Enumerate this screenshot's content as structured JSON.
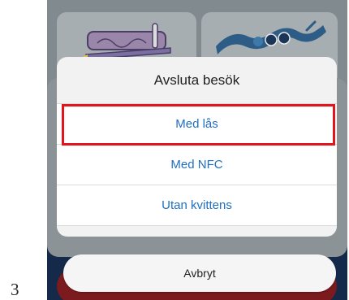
{
  "figure_number": "3",
  "sheet": {
    "title": "Avsluta besök",
    "options": [
      {
        "label": "Med lås",
        "highlighted": true
      },
      {
        "label": "Med NFC",
        "highlighted": false
      },
      {
        "label": "Utan kvittens",
        "highlighted": false
      }
    ]
  },
  "cancel_label": "Avbryt",
  "colors": {
    "option_text": "#1f6fc2",
    "highlight_border": "#e3141b",
    "backdrop": "#818a8e",
    "bottom_band": "#15294b"
  },
  "icons": {
    "left_tile": "pen-and-paper-icon",
    "right_tile": "handshake-icon"
  }
}
